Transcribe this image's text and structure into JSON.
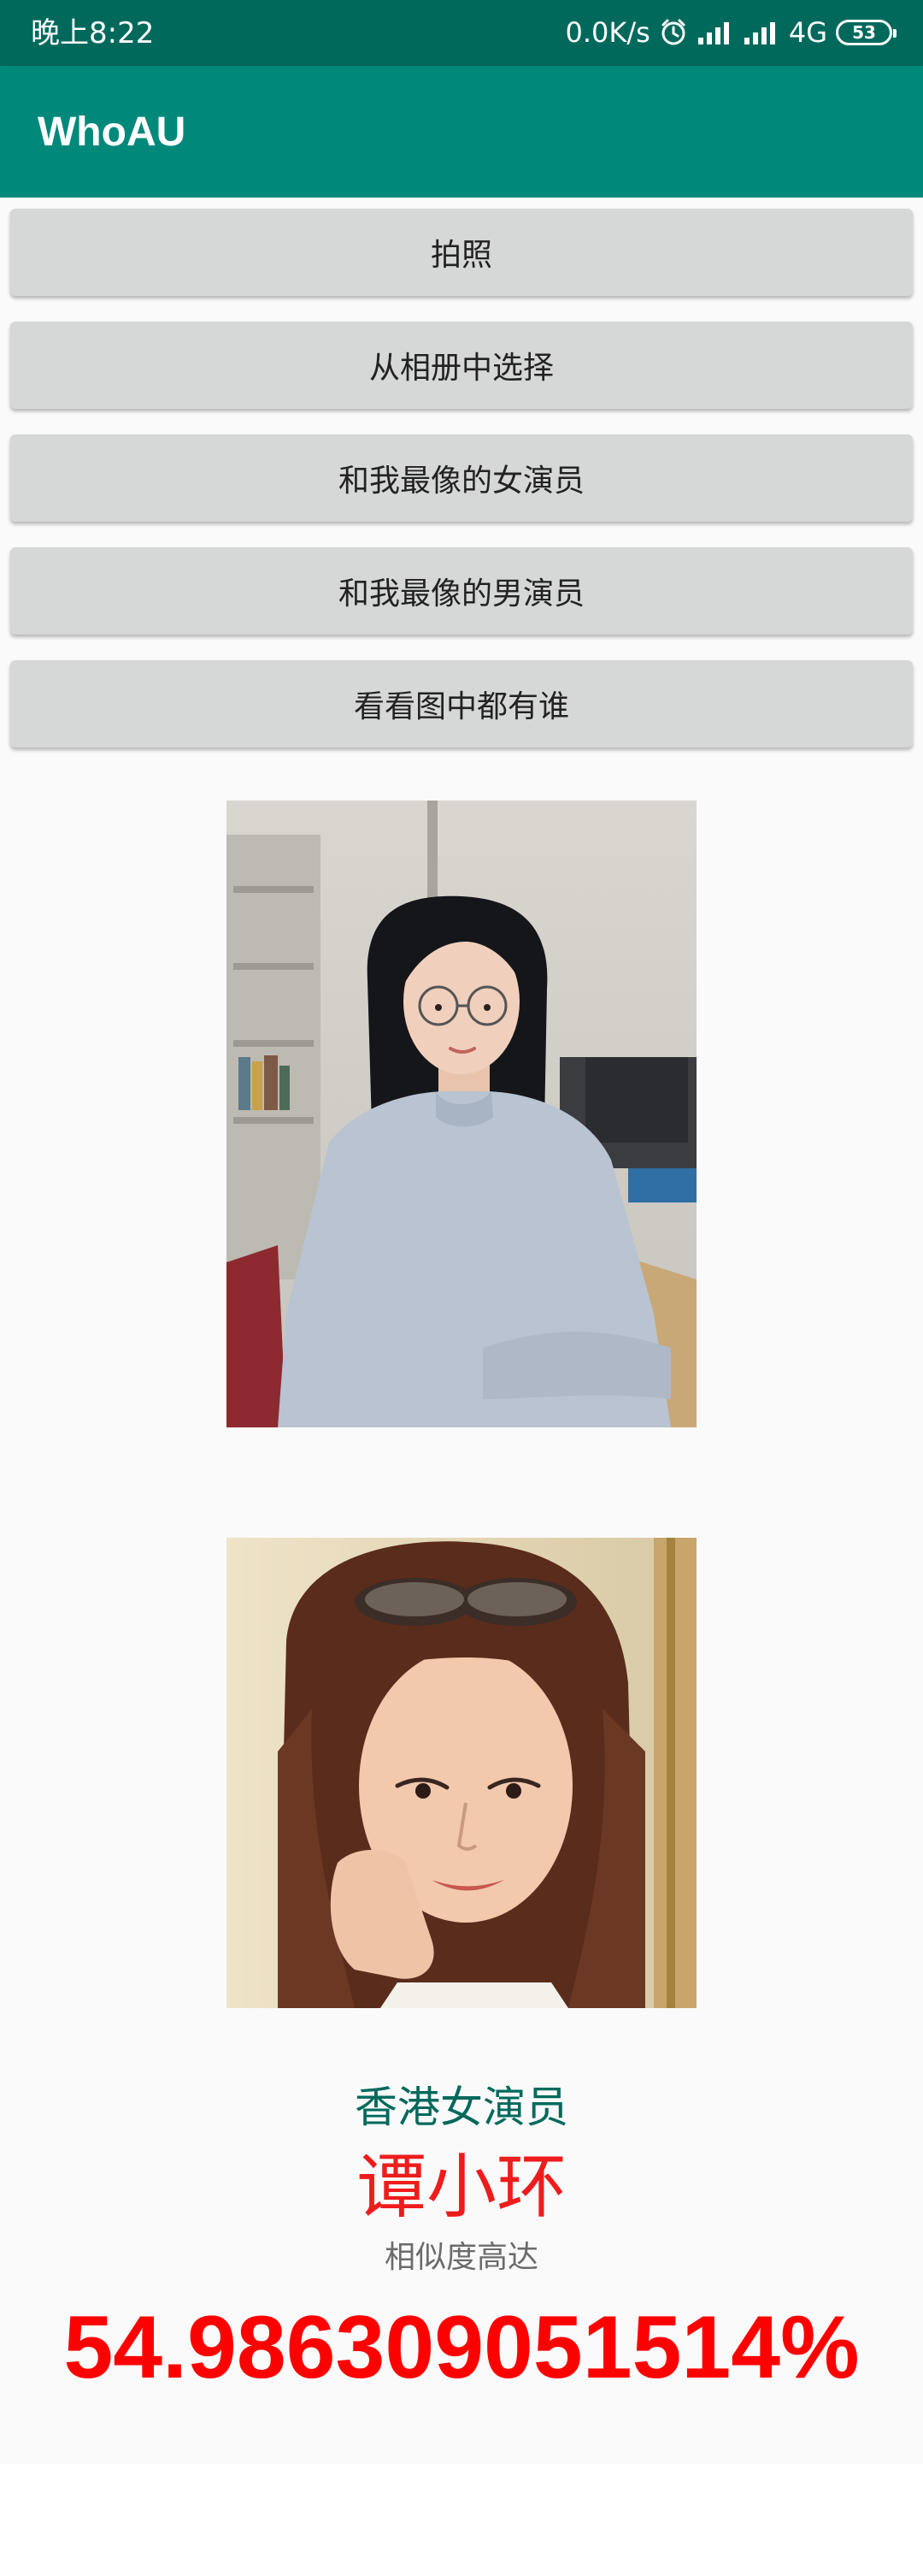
{
  "status_bar": {
    "time": "晚上8:22",
    "net_speed": "0.0K/s",
    "network": "4G",
    "battery": "53",
    "icons": [
      "alarm-icon",
      "signal-icon",
      "signal-icon",
      "battery-icon"
    ]
  },
  "app_bar": {
    "title": "WhoAU"
  },
  "buttons": [
    {
      "label": "拍照"
    },
    {
      "label": "从相册中选择"
    },
    {
      "label": "和我最像的女演员"
    },
    {
      "label": "和我最像的男演员"
    },
    {
      "label": "看看图中都有谁"
    }
  ],
  "result": {
    "category": "香港女演员",
    "name": "谭小环",
    "similarity_label": "相似度高达",
    "similarity_value": "54.986309051514%"
  },
  "colors": {
    "status_bar": "#00695c",
    "app_bar": "#00897b",
    "button_bg": "#d6d7d7",
    "category_text": "#00695c",
    "name_text": "#ee1c1c",
    "score_text": "#ff0000"
  }
}
